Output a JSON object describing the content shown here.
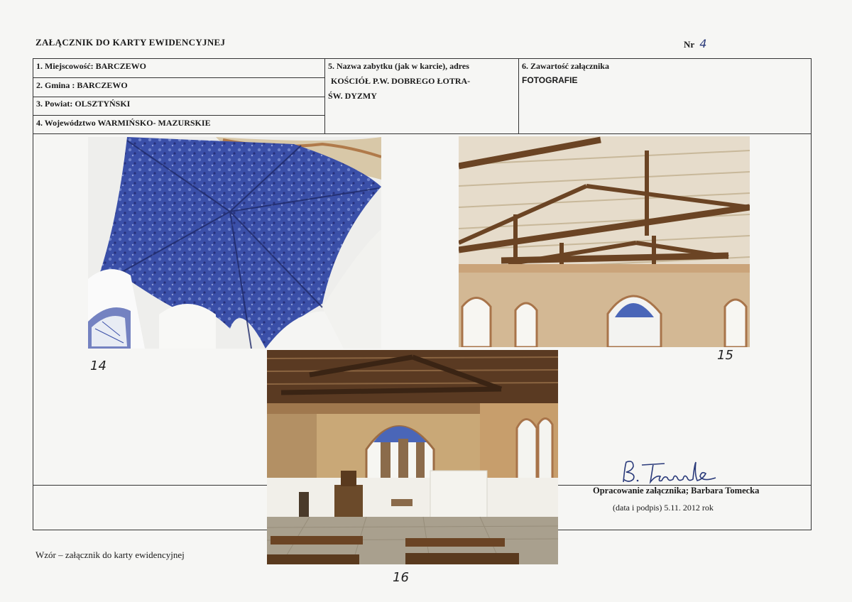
{
  "header": {
    "title": "ZAŁĄCZNIK DO KARTY EWIDENCYJNEJ",
    "nr_label": "Nr",
    "nr_value": "4"
  },
  "fields": {
    "miejscowosc": "1. Miejscowość: BARCZEWO",
    "gmina": "2. Gmina : BARCZEWO",
    "powiat": "3. Powiat: OLSZTYŃSKI",
    "wojewodztwo": "4. Województwo WARMIŃSKO- MAZURSKIE",
    "nazwa_label": "5. Nazwa zabytku (jak w karcie), adres",
    "nazwa_line1": "KOŚCIÓŁ P.W. DOBREGO ŁOTRA-",
    "nazwa_line2": "ŚW. DYZMY",
    "zawartosc_label": "6. Zawartość załącznika",
    "zawartosc_value": "FOTOGRAFIE"
  },
  "photos": [
    {
      "number": "14",
      "subject": "blue-vaulted-ceiling"
    },
    {
      "number": "15",
      "subject": "wooden-roof-trusses"
    },
    {
      "number": "16",
      "subject": "church-interior-nave"
    }
  ],
  "signature": {
    "prepared_by": "Opracowanie załącznika; Barbara Tomecka",
    "date_line": "(data i podpis) 5.11. 2012 rok"
  },
  "footer": {
    "text": "Wzór – załącznik do karty ewidencyjnej"
  },
  "colors": {
    "vault_blue": "#3a4fa8",
    "wood_brown": "#6b4424",
    "wall_ochre": "#c9a877",
    "ink_blue": "#2a3a7a"
  }
}
